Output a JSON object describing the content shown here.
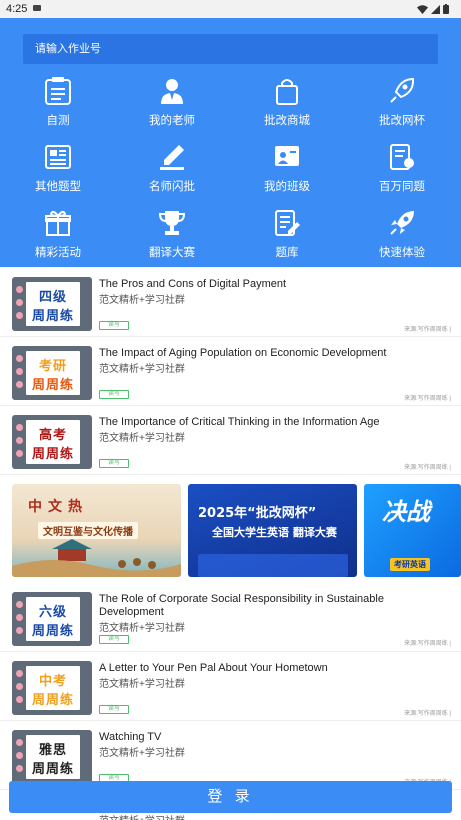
{
  "status_bar": {
    "time": "4:25"
  },
  "search": {
    "placeholder": "请输入作业号"
  },
  "menu": [
    {
      "label": "自测",
      "icon": "clipboard-icon"
    },
    {
      "label": "我的老师",
      "icon": "teacher-icon"
    },
    {
      "label": "批改商城",
      "icon": "shopping-bag-icon"
    },
    {
      "label": "批改网杯",
      "icon": "rocket-badge-icon"
    },
    {
      "label": "其他题型",
      "icon": "newspaper-icon"
    },
    {
      "label": "名师闪批",
      "icon": "pen-icon"
    },
    {
      "label": "我的班级",
      "icon": "classroom-icon"
    },
    {
      "label": "百万同题",
      "icon": "certificate-icon"
    },
    {
      "label": "精彩活动",
      "icon": "gift-icon"
    },
    {
      "label": "翻译大赛",
      "icon": "trophy-icon"
    },
    {
      "label": "题库",
      "icon": "edit-document-icon"
    },
    {
      "label": "快速体验",
      "icon": "rocket-icon"
    }
  ],
  "essays": [
    {
      "thumb_top": "四级",
      "thumb_bottom": "周周练",
      "title": "The Pros and Cons of Digital Payment",
      "subtitle": "范文精析+学习社群",
      "tag": "读写",
      "source": "来源:写作周周练 |"
    },
    {
      "thumb_top": "考研",
      "thumb_bottom": "周周练",
      "title": "The Impact of Aging Population on Economic Development",
      "subtitle": "范文精析+学习社群",
      "tag": "读写",
      "source": "来源:写作周周练 |"
    },
    {
      "thumb_top": "高考",
      "thumb_bottom": "周周练",
      "title": "The Importance of Critical Thinking in the Information Age",
      "subtitle": "范文精析+学习社群",
      "tag": "读写",
      "source": "来源:写作周周练 |"
    },
    {
      "thumb_top": "六级",
      "thumb_bottom": "周周练",
      "title": "The Role of Corporate Social Responsibility in Sustainable Development",
      "subtitle": "范文精析+学习社群",
      "tag": "读写",
      "source": "来源:写作周周练 |"
    },
    {
      "thumb_top": "中考",
      "thumb_bottom": "周周练",
      "title": "A Letter to Your Pen Pal About Your Hometown",
      "subtitle": "范文精析+学习社群",
      "tag": "读写",
      "source": "来源:写作周周练 |"
    },
    {
      "thumb_top": "雅思",
      "thumb_bottom": "周周练",
      "title": "Watching TV",
      "subtitle": "范文精析+学习社群",
      "tag": "读写",
      "source": "来源:写作周周练 |"
    }
  ],
  "banners": {
    "b1_title": "中文热",
    "b1_sub": "文明互鉴与文化传播",
    "b2_line1": "2025年“批改网杯”",
    "b2_line2": "全国大学生英语 翻译大赛",
    "b3_title": "决战",
    "b3_sub": "考研英语"
  },
  "login": {
    "label": "登 录"
  },
  "peek": {
    "subtitle": "范文精析+学习社群"
  },
  "colors": {
    "primary": "#3b8cf4",
    "tag_green": "#4cbf6b"
  }
}
